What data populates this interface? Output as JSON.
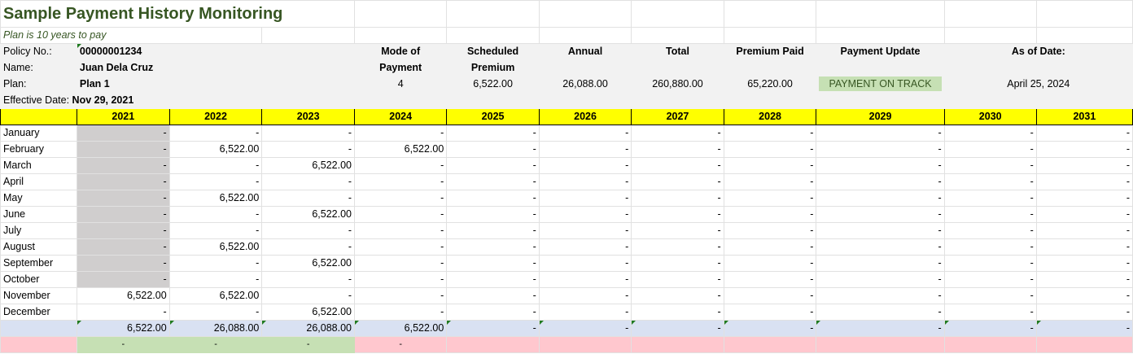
{
  "header": {
    "title": "Sample Payment History Monitoring",
    "subtitle": "Plan is 10 years to pay"
  },
  "policy": {
    "policy_label": "Policy No.:",
    "policy_value": "00000001234",
    "name_label": "Name:",
    "name_value": "Juan Dela Cruz",
    "plan_label": "Plan:",
    "plan_value": "Plan 1",
    "effective_label": "Effective Date:",
    "effective_value": "Nov 29, 2021"
  },
  "summary": {
    "mode_l1": "Mode of",
    "mode_l2": "Payment",
    "mode_value": "4",
    "sched_l1": "Scheduled",
    "sched_l2": "Premium",
    "sched_value": "6,522.00",
    "annual_label": "Annual",
    "annual_value": "26,088.00",
    "total_label": "Total",
    "total_value": "260,880.00",
    "paid_label": "Premium Paid",
    "paid_value": "65,220.00",
    "update_label": "Payment Update",
    "update_value": "PAYMENT ON TRACK",
    "asof_label": "As of Date:",
    "asof_value": "April 25, 2024"
  },
  "years": [
    "2021",
    "2022",
    "2023",
    "2024",
    "2025",
    "2026",
    "2027",
    "2028",
    "2029",
    "2030",
    "2031"
  ],
  "months": [
    {
      "name": "January",
      "values": [
        "-",
        "-",
        "-",
        "-",
        "-",
        "-",
        "-",
        "-",
        "-",
        "-",
        "-"
      ]
    },
    {
      "name": "February",
      "values": [
        "-",
        "6,522.00",
        "-",
        "6,522.00",
        "-",
        "-",
        "-",
        "-",
        "-",
        "-",
        "-"
      ]
    },
    {
      "name": "March",
      "values": [
        "-",
        "-",
        "6,522.00",
        "-",
        "-",
        "-",
        "-",
        "-",
        "-",
        "-",
        "-"
      ]
    },
    {
      "name": "April",
      "values": [
        "-",
        "-",
        "-",
        "-",
        "-",
        "-",
        "-",
        "-",
        "-",
        "-",
        "-"
      ]
    },
    {
      "name": "May",
      "values": [
        "-",
        "6,522.00",
        "-",
        "-",
        "-",
        "-",
        "-",
        "-",
        "-",
        "-",
        "-"
      ]
    },
    {
      "name": "June",
      "values": [
        "-",
        "-",
        "6,522.00",
        "-",
        "-",
        "-",
        "-",
        "-",
        "-",
        "-",
        "-"
      ]
    },
    {
      "name": "July",
      "values": [
        "-",
        "-",
        "-",
        "-",
        "-",
        "-",
        "-",
        "-",
        "-",
        "-",
        "-"
      ]
    },
    {
      "name": "August",
      "values": [
        "-",
        "6,522.00",
        "-",
        "-",
        "-",
        "-",
        "-",
        "-",
        "-",
        "-",
        "-"
      ]
    },
    {
      "name": "September",
      "values": [
        "-",
        "-",
        "6,522.00",
        "-",
        "-",
        "-",
        "-",
        "-",
        "-",
        "-",
        "-"
      ]
    },
    {
      "name": "October",
      "values": [
        "-",
        "-",
        "-",
        "-",
        "-",
        "-",
        "-",
        "-",
        "-",
        "-",
        "-"
      ]
    },
    {
      "name": "November",
      "values": [
        "6,522.00",
        "6,522.00",
        "-",
        "-",
        "-",
        "-",
        "-",
        "-",
        "-",
        "-",
        "-"
      ]
    },
    {
      "name": "December",
      "values": [
        "-",
        "-",
        "6,522.00",
        "-",
        "-",
        "-",
        "-",
        "-",
        "-",
        "-",
        "-"
      ]
    }
  ],
  "totals": [
    "6,522.00",
    "26,088.00",
    "26,088.00",
    "6,522.00",
    "-",
    "-",
    "-",
    "-",
    "-",
    "-",
    "-"
  ],
  "balance": [
    "-",
    "-",
    "-",
    "-",
    "",
    "",
    "",
    "",
    "",
    "",
    ""
  ],
  "colors": {
    "title": "#375623",
    "header_yellow": "#ffff00",
    "totals_blue": "#d9e1f2",
    "balance_pink": "#ffc7ce",
    "balance_green": "#c6e0b4",
    "unpaid_grey": "#d0cece"
  }
}
